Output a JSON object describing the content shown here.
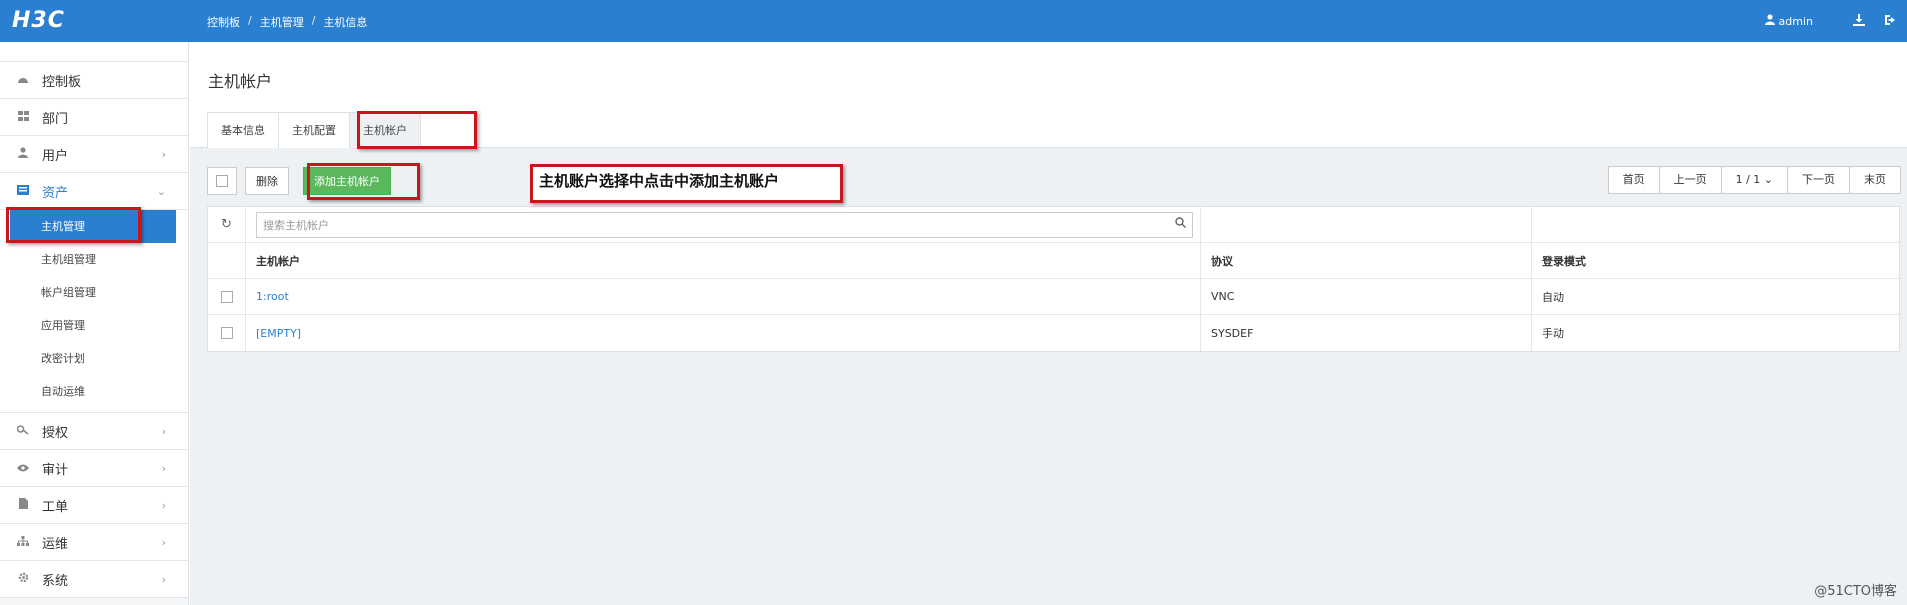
{
  "brand": {
    "logo": "H3C"
  },
  "breadcrumb": [
    "控制板",
    "主机管理",
    "主机信息"
  ],
  "breadcrumb_sep": "/",
  "topbar": {
    "user": "admin"
  },
  "sidebar": {
    "items": [
      {
        "label": "控制板",
        "icon": "dashboard-icon"
      },
      {
        "label": "部门",
        "icon": "grid-icon"
      },
      {
        "label": "用户",
        "icon": "user-icon",
        "chevron": "›"
      },
      {
        "label": "资产",
        "icon": "asset-icon",
        "chevron": "⌄",
        "open": true
      }
    ],
    "sub_items": [
      "主机管理",
      "主机组管理",
      "帐户组管理",
      "应用管理",
      "改密计划",
      "自动运维"
    ],
    "active_sub": "主机管理",
    "items_after": [
      {
        "label": "授权",
        "icon": "key-icon",
        "chevron": "›"
      },
      {
        "label": "审计",
        "icon": "eye-icon",
        "chevron": "›"
      },
      {
        "label": "工单",
        "icon": "document-icon",
        "chevron": "›"
      },
      {
        "label": "运维",
        "icon": "sitemap-icon",
        "chevron": "›"
      },
      {
        "label": "系统",
        "icon": "gear-icon",
        "chevron": "›"
      }
    ]
  },
  "main": {
    "title": "主机帐户",
    "tabs": [
      "基本信息",
      "主机配置",
      "主机帐户"
    ],
    "active_tab": "主机帐户",
    "toolbar": {
      "delete_label": "删除",
      "add_label": "添加主机帐户"
    },
    "pager": {
      "first": "首页",
      "prev": "上一页",
      "page": "1 / 1",
      "next": "下一页",
      "last": "末页"
    },
    "search_placeholder": "搜索主机帐户",
    "columns": [
      "主机帐户",
      "协议",
      "登录模式"
    ],
    "rows": [
      {
        "account": "1:root",
        "protocol": "VNC",
        "mode": "自动"
      },
      {
        "account": "[EMPTY]",
        "protocol": "SYSDEF",
        "mode": "手动"
      }
    ]
  },
  "annotation": "主机账户选择中点击中添加主机账户",
  "watermark": "@51CTO博客",
  "colors": {
    "topbar": "#2b7fd0",
    "accent": "#2b7fd0",
    "add_button": "#5cb85c",
    "annotation_border": "#c8161d"
  }
}
